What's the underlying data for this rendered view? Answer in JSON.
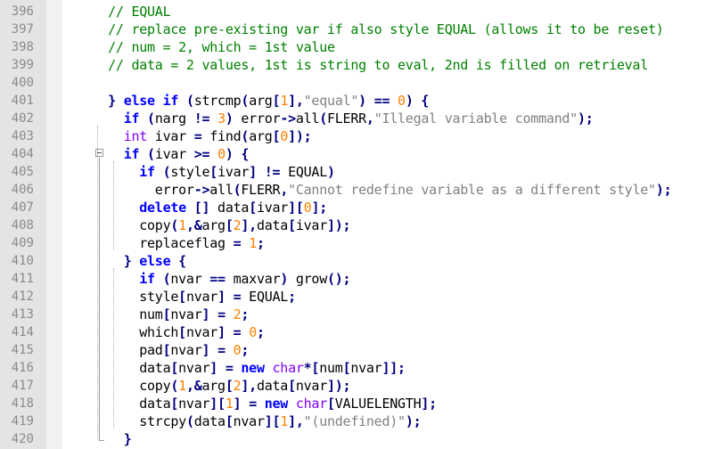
{
  "editor": {
    "lines": [
      {
        "num": "396",
        "tokens": [
          {
            "t": "    "
          },
          {
            "c": "c",
            "t": "// EQUAL"
          }
        ]
      },
      {
        "num": "397",
        "tokens": [
          {
            "t": "    "
          },
          {
            "c": "c",
            "t": "// replace pre-existing var if also style EQUAL (allows it to be reset)"
          }
        ]
      },
      {
        "num": "398",
        "tokens": [
          {
            "t": "    "
          },
          {
            "c": "c",
            "t": "// num = 2, which = 1st value"
          }
        ]
      },
      {
        "num": "399",
        "tokens": [
          {
            "t": "    "
          },
          {
            "c": "c",
            "t": "// data = 2 values, 1st is string to eval, 2nd is filled on retrieval"
          }
        ]
      },
      {
        "num": "400",
        "tokens": []
      },
      {
        "num": "401",
        "tokens": [
          {
            "t": "    "
          },
          {
            "c": "o",
            "t": "}"
          },
          {
            "t": " "
          },
          {
            "c": "k",
            "t": "else"
          },
          {
            "t": " "
          },
          {
            "c": "k",
            "t": "if"
          },
          {
            "t": " "
          },
          {
            "c": "o",
            "t": "("
          },
          {
            "t": "strcmp"
          },
          {
            "c": "o",
            "t": "("
          },
          {
            "t": "arg"
          },
          {
            "c": "o",
            "t": "["
          },
          {
            "c": "n",
            "t": "1"
          },
          {
            "c": "o",
            "t": "],"
          },
          {
            "c": "s",
            "t": "\"equal\""
          },
          {
            "c": "o",
            "t": ")"
          },
          {
            "t": " "
          },
          {
            "c": "o",
            "t": "=="
          },
          {
            "t": " "
          },
          {
            "c": "n",
            "t": "0"
          },
          {
            "c": "o",
            "t": ")"
          },
          {
            "t": " "
          },
          {
            "c": "o",
            "t": "{"
          }
        ]
      },
      {
        "num": "402",
        "tokens": [
          {
            "t": "      "
          },
          {
            "c": "k",
            "t": "if"
          },
          {
            "t": " "
          },
          {
            "c": "o",
            "t": "("
          },
          {
            "t": "narg "
          },
          {
            "c": "o",
            "t": "!="
          },
          {
            "t": " "
          },
          {
            "c": "n",
            "t": "3"
          },
          {
            "c": "o",
            "t": ")"
          },
          {
            "t": " error"
          },
          {
            "c": "o",
            "t": "->"
          },
          {
            "t": "all"
          },
          {
            "c": "o",
            "t": "("
          },
          {
            "t": "FLERR"
          },
          {
            "c": "o",
            "t": ","
          },
          {
            "c": "s",
            "t": "\"Illegal variable command\""
          },
          {
            "c": "o",
            "t": ");"
          }
        ]
      },
      {
        "num": "403",
        "tokens": [
          {
            "t": "      "
          },
          {
            "c": "t",
            "t": "int"
          },
          {
            "t": " ivar "
          },
          {
            "c": "o",
            "t": "="
          },
          {
            "t": " find"
          },
          {
            "c": "o",
            "t": "("
          },
          {
            "t": "arg"
          },
          {
            "c": "o",
            "t": "["
          },
          {
            "c": "n",
            "t": "0"
          },
          {
            "c": "o",
            "t": "]);"
          }
        ]
      },
      {
        "num": "404",
        "tokens": [
          {
            "t": "      "
          },
          {
            "c": "k",
            "t": "if"
          },
          {
            "t": " "
          },
          {
            "c": "o",
            "t": "("
          },
          {
            "t": "ivar "
          },
          {
            "c": "o",
            "t": ">="
          },
          {
            "t": " "
          },
          {
            "c": "n",
            "t": "0"
          },
          {
            "c": "o",
            "t": ")"
          },
          {
            "t": " "
          },
          {
            "c": "o",
            "t": "{"
          }
        ]
      },
      {
        "num": "405",
        "tokens": [
          {
            "t": "        "
          },
          {
            "c": "k",
            "t": "if"
          },
          {
            "t": " "
          },
          {
            "c": "o",
            "t": "("
          },
          {
            "t": "style"
          },
          {
            "c": "o",
            "t": "["
          },
          {
            "t": "ivar"
          },
          {
            "c": "o",
            "t": "]"
          },
          {
            "t": " "
          },
          {
            "c": "o",
            "t": "!="
          },
          {
            "t": " EQUAL"
          },
          {
            "c": "o",
            "t": ")"
          }
        ]
      },
      {
        "num": "406",
        "tokens": [
          {
            "t": "          error"
          },
          {
            "c": "o",
            "t": "->"
          },
          {
            "t": "all"
          },
          {
            "c": "o",
            "t": "("
          },
          {
            "t": "FLERR"
          },
          {
            "c": "o",
            "t": ","
          },
          {
            "c": "s",
            "t": "\"Cannot redefine variable as a different style\""
          },
          {
            "c": "o",
            "t": ");"
          }
        ]
      },
      {
        "num": "407",
        "tokens": [
          {
            "t": "        "
          },
          {
            "c": "k",
            "t": "delete"
          },
          {
            "t": " "
          },
          {
            "c": "o",
            "t": "[]"
          },
          {
            "t": " data"
          },
          {
            "c": "o",
            "t": "["
          },
          {
            "t": "ivar"
          },
          {
            "c": "o",
            "t": "]["
          },
          {
            "c": "n",
            "t": "0"
          },
          {
            "c": "o",
            "t": "];"
          }
        ]
      },
      {
        "num": "408",
        "tokens": [
          {
            "t": "        copy"
          },
          {
            "c": "o",
            "t": "("
          },
          {
            "c": "n",
            "t": "1"
          },
          {
            "c": "o",
            "t": ",&"
          },
          {
            "t": "arg"
          },
          {
            "c": "o",
            "t": "["
          },
          {
            "c": "n",
            "t": "2"
          },
          {
            "c": "o",
            "t": "],"
          },
          {
            "t": "data"
          },
          {
            "c": "o",
            "t": "["
          },
          {
            "t": "ivar"
          },
          {
            "c": "o",
            "t": "]);"
          }
        ]
      },
      {
        "num": "409",
        "tokens": [
          {
            "t": "        replaceflag "
          },
          {
            "c": "o",
            "t": "="
          },
          {
            "t": " "
          },
          {
            "c": "n",
            "t": "1"
          },
          {
            "c": "o",
            "t": ";"
          }
        ]
      },
      {
        "num": "410",
        "tokens": [
          {
            "t": "      "
          },
          {
            "c": "o",
            "t": "}"
          },
          {
            "t": " "
          },
          {
            "c": "k",
            "t": "else"
          },
          {
            "t": " "
          },
          {
            "c": "o",
            "t": "{"
          }
        ]
      },
      {
        "num": "411",
        "tokens": [
          {
            "t": "        "
          },
          {
            "c": "k",
            "t": "if"
          },
          {
            "t": " "
          },
          {
            "c": "o",
            "t": "("
          },
          {
            "t": "nvar "
          },
          {
            "c": "o",
            "t": "=="
          },
          {
            "t": " maxvar"
          },
          {
            "c": "o",
            "t": ")"
          },
          {
            "t": " grow"
          },
          {
            "c": "o",
            "t": "();"
          }
        ]
      },
      {
        "num": "412",
        "tokens": [
          {
            "t": "        style"
          },
          {
            "c": "o",
            "t": "["
          },
          {
            "t": "nvar"
          },
          {
            "c": "o",
            "t": "]"
          },
          {
            "t": " "
          },
          {
            "c": "o",
            "t": "="
          },
          {
            "t": " EQUAL"
          },
          {
            "c": "o",
            "t": ";"
          }
        ]
      },
      {
        "num": "413",
        "tokens": [
          {
            "t": "        num"
          },
          {
            "c": "o",
            "t": "["
          },
          {
            "t": "nvar"
          },
          {
            "c": "o",
            "t": "]"
          },
          {
            "t": " "
          },
          {
            "c": "o",
            "t": "="
          },
          {
            "t": " "
          },
          {
            "c": "n",
            "t": "2"
          },
          {
            "c": "o",
            "t": ";"
          }
        ]
      },
      {
        "num": "414",
        "tokens": [
          {
            "t": "        which"
          },
          {
            "c": "o",
            "t": "["
          },
          {
            "t": "nvar"
          },
          {
            "c": "o",
            "t": "]"
          },
          {
            "t": " "
          },
          {
            "c": "o",
            "t": "="
          },
          {
            "t": " "
          },
          {
            "c": "n",
            "t": "0"
          },
          {
            "c": "o",
            "t": ";"
          }
        ]
      },
      {
        "num": "415",
        "tokens": [
          {
            "t": "        pad"
          },
          {
            "c": "o",
            "t": "["
          },
          {
            "t": "nvar"
          },
          {
            "c": "o",
            "t": "]"
          },
          {
            "t": " "
          },
          {
            "c": "o",
            "t": "="
          },
          {
            "t": " "
          },
          {
            "c": "n",
            "t": "0"
          },
          {
            "c": "o",
            "t": ";"
          }
        ]
      },
      {
        "num": "416",
        "tokens": [
          {
            "t": "        data"
          },
          {
            "c": "o",
            "t": "["
          },
          {
            "t": "nvar"
          },
          {
            "c": "o",
            "t": "]"
          },
          {
            "t": " "
          },
          {
            "c": "o",
            "t": "="
          },
          {
            "t": " "
          },
          {
            "c": "k",
            "t": "new"
          },
          {
            "t": " "
          },
          {
            "c": "t",
            "t": "char"
          },
          {
            "c": "o",
            "t": "*["
          },
          {
            "t": "num"
          },
          {
            "c": "o",
            "t": "["
          },
          {
            "t": "nvar"
          },
          {
            "c": "o",
            "t": "]];"
          }
        ]
      },
      {
        "num": "417",
        "tokens": [
          {
            "t": "        copy"
          },
          {
            "c": "o",
            "t": "("
          },
          {
            "c": "n",
            "t": "1"
          },
          {
            "c": "o",
            "t": ",&"
          },
          {
            "t": "arg"
          },
          {
            "c": "o",
            "t": "["
          },
          {
            "c": "n",
            "t": "2"
          },
          {
            "c": "o",
            "t": "],"
          },
          {
            "t": "data"
          },
          {
            "c": "o",
            "t": "["
          },
          {
            "t": "nvar"
          },
          {
            "c": "o",
            "t": "]);"
          }
        ]
      },
      {
        "num": "418",
        "tokens": [
          {
            "t": "        data"
          },
          {
            "c": "o",
            "t": "["
          },
          {
            "t": "nvar"
          },
          {
            "c": "o",
            "t": "]["
          },
          {
            "c": "n",
            "t": "1"
          },
          {
            "c": "o",
            "t": "]"
          },
          {
            "t": " "
          },
          {
            "c": "o",
            "t": "="
          },
          {
            "t": " "
          },
          {
            "c": "k",
            "t": "new"
          },
          {
            "t": " "
          },
          {
            "c": "t",
            "t": "char"
          },
          {
            "c": "o",
            "t": "["
          },
          {
            "t": "VALUELENGTH"
          },
          {
            "c": "o",
            "t": "];"
          }
        ]
      },
      {
        "num": "419",
        "tokens": [
          {
            "t": "        strcpy"
          },
          {
            "c": "o",
            "t": "("
          },
          {
            "t": "data"
          },
          {
            "c": "o",
            "t": "["
          },
          {
            "t": "nvar"
          },
          {
            "c": "o",
            "t": "]["
          },
          {
            "c": "n",
            "t": "1"
          },
          {
            "c": "o",
            "t": "],"
          },
          {
            "c": "s",
            "t": "\"(undefined)\""
          },
          {
            "c": "o",
            "t": ");"
          }
        ]
      },
      {
        "num": "420",
        "tokens": [
          {
            "t": "      "
          },
          {
            "c": "o",
            "t": "}"
          }
        ]
      }
    ]
  },
  "colors": {
    "comment": "#008000",
    "keyword": "#0000ff",
    "type": "#8000ff",
    "number": "#ff8000",
    "string": "#808080",
    "operator": "#000080",
    "gutter": "#e4e4e4",
    "line_number": "#8a8a8a"
  },
  "icons": {
    "fold": "fold-minus-icon"
  }
}
